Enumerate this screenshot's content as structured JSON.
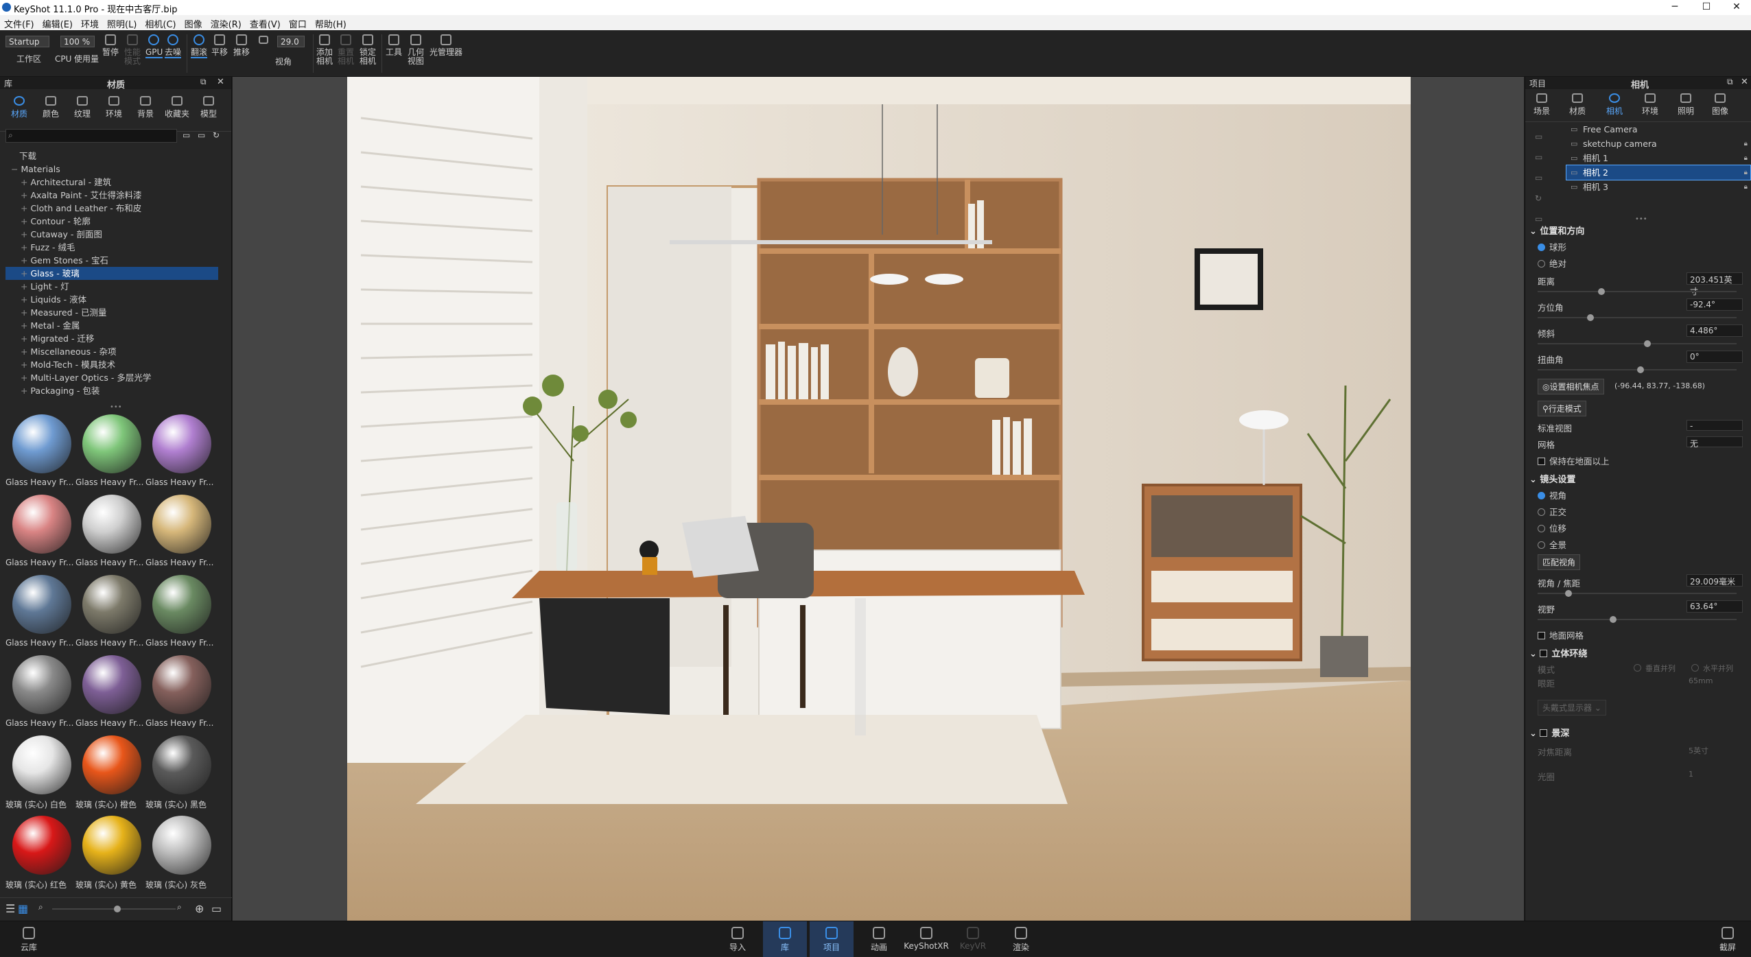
{
  "window": {
    "title": "KeyShot 11.1.0 Pro - 现在中古客厅.bip",
    "minimize": "─",
    "maximize": "☐",
    "close": "✕"
  },
  "menu": [
    "文件(F)",
    "编辑(E)",
    "环境",
    "照明(L)",
    "相机(C)",
    "图像",
    "渲染(R)",
    "查看(V)",
    "窗口",
    "帮助(H)"
  ],
  "toolbar": {
    "workspace_value": "Startup",
    "workspace_label": "工作区",
    "zoom_value": "100 %",
    "fov_value": "29.0",
    "cpu": "CPU",
    "gpu": "GPU",
    "usage": "使用量",
    "pause": "暂停",
    "perf_mode": "性能模式",
    "denoise": "去噪",
    "tumble": "翻滚",
    "pan": "平移",
    "dolly": "推移",
    "view": "视角",
    "add_camera": "添加相机",
    "reset_camera": "重置相机",
    "lock_camera": "锁定相机",
    "tools": "工具",
    "geometry_view": "几何视图",
    "light_manager": "光管理器"
  },
  "library": {
    "header": "库",
    "title": "材质",
    "tabs": [
      "材质",
      "颜色",
      "纹理",
      "环境",
      "背景",
      "收藏夹",
      "模型"
    ],
    "search_placeholder": "",
    "tree": [
      {
        "label": "下载",
        "indent": 1,
        "selected": false
      },
      {
        "label": "Materials",
        "indent": 0,
        "selected": false
      },
      {
        "label": "Architectural - 建筑",
        "indent": 2,
        "selected": false
      },
      {
        "label": "Axalta Paint - 艾仕得涂料漆",
        "indent": 2,
        "selected": false
      },
      {
        "label": "Cloth and Leather - 布和皮",
        "indent": 2,
        "selected": false
      },
      {
        "label": "Contour - 轮廓",
        "indent": 2,
        "selected": false
      },
      {
        "label": "Cutaway - 剖面图",
        "indent": 2,
        "selected": false
      },
      {
        "label": "Fuzz - 绒毛",
        "indent": 2,
        "selected": false
      },
      {
        "label": "Gem Stones - 宝石",
        "indent": 2,
        "selected": false
      },
      {
        "label": "Glass - 玻璃",
        "indent": 2,
        "selected": true
      },
      {
        "label": "Light - 灯",
        "indent": 2,
        "selected": false
      },
      {
        "label": "Liquids - 液体",
        "indent": 2,
        "selected": false
      },
      {
        "label": "Measured - 已测量",
        "indent": 2,
        "selected": false
      },
      {
        "label": "Metal - 金属",
        "indent": 2,
        "selected": false
      },
      {
        "label": "Migrated - 迁移",
        "indent": 2,
        "selected": false
      },
      {
        "label": "Miscellaneous - 杂项",
        "indent": 2,
        "selected": false
      },
      {
        "label": "Mold-Tech - 模具技术",
        "indent": 2,
        "selected": false
      },
      {
        "label": "Multi-Layer Optics - 多层光学",
        "indent": 2,
        "selected": false
      },
      {
        "label": "Packaging - 包装",
        "indent": 2,
        "selected": false
      }
    ],
    "thumbnails": [
      {
        "label": "Glass Heavy Fr...",
        "color": "#6f9bd1"
      },
      {
        "label": "Glass Heavy Fr...",
        "color": "#7fc67a"
      },
      {
        "label": "Glass Heavy Fr...",
        "color": "#b07fd0"
      },
      {
        "label": "Glass Heavy Fr...",
        "color": "#d98484"
      },
      {
        "label": "Glass Heavy Fr...",
        "color": "#cfcfcf"
      },
      {
        "label": "Glass Heavy Fr...",
        "color": "#d6b77a"
      },
      {
        "label": "Glass Heavy Fr...",
        "color": "#5f7896"
      },
      {
        "label": "Glass Heavy Fr...",
        "color": "#7d7a6a"
      },
      {
        "label": "Glass Heavy Fr...",
        "color": "#6a8a62"
      },
      {
        "label": "Glass Heavy Fr...",
        "color": "#8a8a8a"
      },
      {
        "label": "Glass Heavy Fr...",
        "color": "#7e5f96"
      },
      {
        "label": "Glass Heavy Fr...",
        "color": "#85605c"
      },
      {
        "label": "玻璃 (实心) 白色",
        "color": "#e6e6e6"
      },
      {
        "label": "玻璃 (实心) 橙色",
        "color": "#e8561a"
      },
      {
        "label": "玻璃 (实心) 黑色",
        "color": "#5a5a5a"
      },
      {
        "label": "玻璃 (实心) 红色",
        "color": "#d81818"
      },
      {
        "label": "玻璃 (实心) 黄色",
        "color": "#e6b21a"
      },
      {
        "label": "玻璃 (实心) 灰色",
        "color": "#bdbdbd"
      }
    ]
  },
  "project": {
    "header": "项目",
    "title": "相机",
    "tabs": [
      "场景",
      "材质",
      "相机",
      "环境",
      "照明",
      "图像"
    ],
    "cameras": [
      {
        "name": "Free Camera",
        "selected": false,
        "locked": false
      },
      {
        "name": "sketchup camera",
        "selected": false,
        "locked": true
      },
      {
        "name": "相机 1",
        "selected": false,
        "locked": true
      },
      {
        "name": "相机 2",
        "selected": true,
        "locked": true
      },
      {
        "name": "相机 3",
        "selected": false,
        "locked": true
      }
    ],
    "position_section": "位置和方向",
    "mode_orbit": "球形",
    "mode_absolute": "绝对",
    "distance_label": "距离",
    "distance_value": "203.451英寸",
    "azimuth_label": "方位角",
    "azimuth_value": "-92.4°",
    "incline_label": "倾斜",
    "incline_value": "4.486°",
    "twist_label": "扭曲角",
    "twist_value": "0°",
    "set_focus_button": "设置相机焦点",
    "focus_coords": "(-96.44, 83.77, -138.68)",
    "walk_mode_button": "行走模式",
    "standard_view_label": "标准视图",
    "standard_view_value": "-",
    "grid_label": "网格",
    "grid_value": "无",
    "keep_above_ground": "保持在地面以上",
    "lens_section": "镜头设置",
    "lens_perspective": "视角",
    "lens_ortho": "正交",
    "lens_shift": "位移",
    "lens_panorama": "全景",
    "match_perspective_button": "匹配视角",
    "focal_label": "视角 / 焦距",
    "focal_value": "29.009毫米",
    "fov_label": "视野",
    "fov_value": "63.64°",
    "ground_grid": "地面网格",
    "stereo_section": "立体环绕",
    "stereo_mode_label": "模式",
    "stereo_vertical": "垂直并列",
    "stereo_horizontal": "水平并列",
    "eye_sep_label": "眼距",
    "eye_sep_value": "65mm",
    "hmd_button": "头戴式显示器",
    "dof_section": "景深",
    "focus_distance_label": "对焦距离",
    "focus_distance_value": "5英寸",
    "aperture_label": "光圈",
    "aperture_value": "1"
  },
  "bottombar": {
    "cloud": "云库",
    "import": "导入",
    "library": "库",
    "project": "项目",
    "animation": "动画",
    "keyshotxr": "KeyShotXR",
    "keyvr": "KeyVR",
    "render": "渲染",
    "screenshot": "截屏"
  }
}
